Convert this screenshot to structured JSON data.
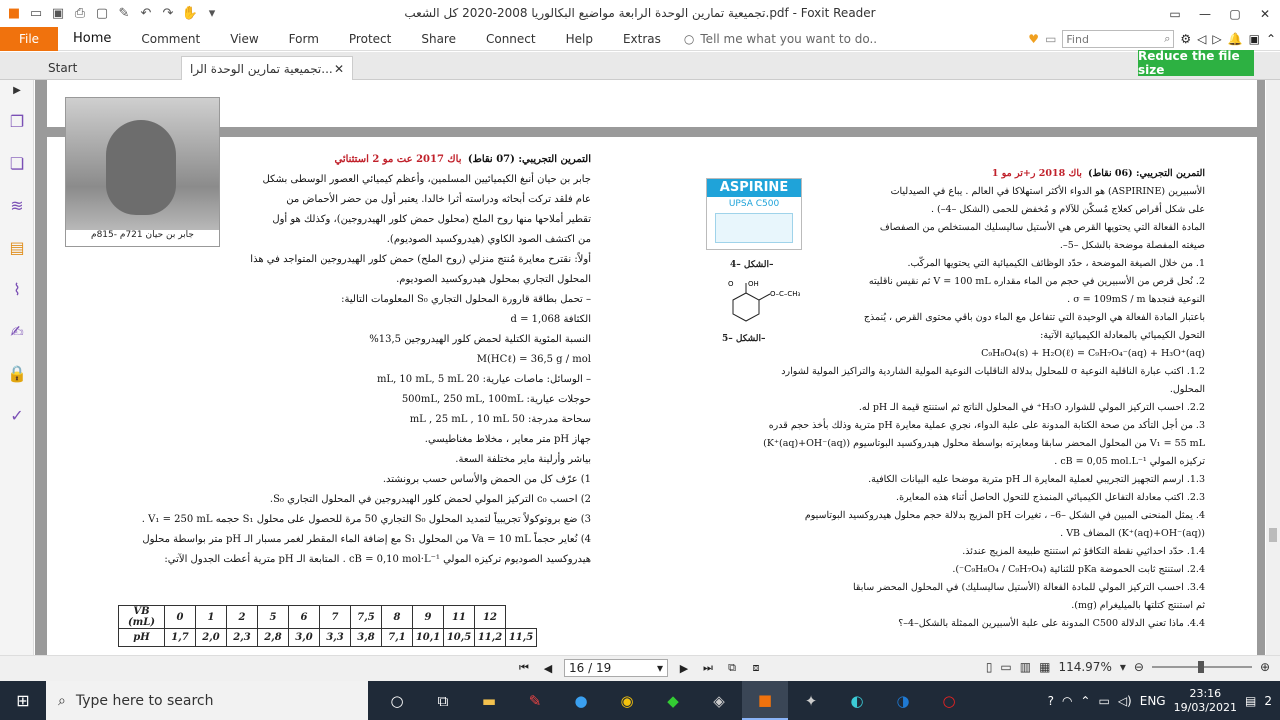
{
  "window": {
    "title": "تجميعية تمارين الوحدة الرابعة مواضيع البكالوريا 2008-2020 كل الشعب.pdf - Foxit Reader"
  },
  "ribbon": {
    "file": "File",
    "tabs": [
      "Home",
      "Comment",
      "View",
      "Form",
      "Protect",
      "Share",
      "Connect",
      "Help",
      "Extras"
    ],
    "tell_me": "Tell me what you want to do..",
    "find_placeholder": "Find"
  },
  "tabs": {
    "start": "Start",
    "document": "تجميعية تمارين الوحدة الرا..."
  },
  "promo": {
    "reduce": "Reduce the file size"
  },
  "page": {
    "left": {
      "heading": "التمرين التجريبي: (07 نقاط)",
      "ref": "باك 2017 عت مو 2 استثنائي",
      "lines": [
        "جابر بن حيان أنبغ الكيميائيين المسلمين، وأعظم كيميائي العصور الوسطى بشكل",
        "عام فلقد تركت أبحاثه ودراسته أثرا خالدا. يعتبر أول من حضر الأحماض من",
        "تقطير أملاحها منها روح الملح (محلول حمض كلور الهيدروجين)، وكذلك هو أول",
        "من اكتشف الصود الكاوي (هيدروكسيد الصوديوم).",
        "أولاً: نقترح معايرة مُنتج منزلي (روح الملح) حمض كلور الهيدروجين المتواجد في هذا",
        "المحلول التجاري بمحلول هيدروكسيد الصوديوم.",
        "– تحمل بطاقة قارورة المحلول التجاري S₀ المعلومات التالية:",
        "الكثافة d = 1,068",
        "النسبة المئوية الكتلية لحمض كلور الهيدروجين 13,5%",
        "M(HCℓ) = 36,5 g / mol",
        "– الوسائل: ماصات عيارية: 20 mL, 10 mL, 5 mL",
        "حوجلات عيارية: 500mL, 250 mL, 100mL",
        "سحاحة مدرجة: 50 mL , 25 mL , 10 mL",
        "جهاز pH متر معاير ، مخلاط مغناطيسي.",
        "بياشر وأرلينة ماير مختلفة السعة.",
        "1) عرّف كل من الحمض والأساس حسب برونشتد.",
        "2) احسب c₀ التركيز المولي لحمض كلور الهيدروجين في المحلول التجاري S₀.",
        "3) ضع بروتوكولاً تجريبياً لتمديد المحلول S₀ التجاري 50 مرة للحصول على محلول S₁ حجمه V₁ = 250 mL .",
        "4) نُعاير حجماً Va = 10 mL من المحلول S₁ مع إضافة الماء المقطر لغمر مسبار الـ pH متر بواسطة محلول",
        "هيدروكسيد الصوديوم تركيزه المولي cB = 0,10 mol·L⁻¹ . المتابعة الـ pH مترية أعطت الجدول الآتي:"
      ],
      "portrait_caption": "جابر بن حيان 721م -815م",
      "table": {
        "row1_label": "VB (mL)",
        "row1": [
          "0",
          "1",
          "2",
          "5",
          "6",
          "7",
          "7,5",
          "8",
          "9",
          "11",
          "12"
        ],
        "row2_label": "pH",
        "row2": [
          "1,7",
          "2,0",
          "2,3",
          "2,8",
          "3,0",
          "3,3",
          "3,8",
          "7,1",
          "10,1",
          "10,5",
          "11,2",
          "11,5"
        ]
      }
    },
    "right": {
      "heading": "التمرين التجريبي: (06 نقاط)",
      "ref": "باك 2018 ر+تر مو 1",
      "lines": [
        "الأسبيرين (ASPIRINE) هو الدواء الأكثر استهلاكا في العالم . يباع في الصيدليات",
        "على شكل أقراص كعلاج مُسكّن للآلام و مُخفض للحمى (الشكل –4–) .",
        "المادة الفعالة التي يحتويها القرص هي الأستيل ساليسليك المستخلص من الصفصاف",
        "صيغته المفصلة موضحة بالشكل –5–.",
        "1. من خلال الصيغة الموضحة ، حدّد الوظائف الكيميائية التي يحتويها المركّب.",
        "2. نُحل قرص من الأسبيرين في حجم من الماء مقداره V = 100 mL ثم نقيس ناقليته",
        "النوعية فنجدها σ = 109mS / m .",
        "باعتبار المادة الفعالة هي الوحيدة التي تتفاعل مع الماء دون باقي محتوى القرص ، يُنمذج",
        "التحول الكيميائي بالمعادلة الكيميائية الآتية:",
        "C₉H₈O₄(s) + H₂O(ℓ) = C₉H₇O₄⁻(aq) + H₃O⁺(aq)",
        "1.2. اكتب عبارة الناقلية النوعية σ للمحلول بدلالة الناقليات النوعية المولية الشاردية والتراكيز المولية لشوارد",
        "المحلول.",
        "2.2. احسب التركيز المولي للشوارد H₃O⁺ في المحلول الناتج ثم استنتج قيمة الـ pH له.",
        "3. من أجل التأكد من صحة الكتابة المدونة على علبة الدواء، نجري عملية معايرة pH مترية وذلك بأخذ حجم قدره",
        "V₁ = 55 mL من المحلول المحضر سابقا ومعايرته بواسطة محلول هيدروكسيد البوتاسيوم (K⁺(aq)+OH⁻(aq))",
        "تركيزه المولي cB = 0,05 mol.L⁻¹ .",
        "1.3. ارسم التجهيز التجريبي لعملية المعايرة الـ pH مترية موضحا عليه البيانات الكافية.",
        "2.3. اكتب معادلة التفاعل الكيميائي المنمذج للتحول الحاصل أثناء هذه المعايرة.",
        "4. يمثل المنحنى المبين في الشكل –6– ، تغيرات pH المزيج بدلالة حجم محلول هيدروكسيد البوتاسيوم",
        "(K⁺(aq)+OH⁻(aq)) المضاف VB .",
        "1.4. حدّد احداثيي نقطة التكافؤ ثم استنتج طبيعة المزيج عندئذ.",
        "2.4. استنتج ثابت الحموضة pKa للثنائية (C₉H₈O₄ / C₉H₇O₄⁻).",
        "3.4. احسب التركيز المولي للمادة الفعالة (الأستيل ساليسليك) في المحلول المحضر سابقا",
        "ثم استنتج كتلتها بالميليغرام (mg).",
        "4.4. ماذا تعني الدلالة C500 المدونة على علبة الأسبيرين الممثلة بالشكل–4–؟"
      ],
      "fig4": "الشكل –4–",
      "fig5": "الشكل –5–",
      "aspirine_brand": "ASPIRINE",
      "aspirine_sub": "UPSA  C500"
    }
  },
  "status": {
    "page_indicator": "16 / 19",
    "zoom": "114.97%"
  },
  "taskbar": {
    "search_placeholder": "Type here to search",
    "lang": "ENG",
    "time": "23:16",
    "date": "19/03/2021",
    "notif": "2"
  }
}
